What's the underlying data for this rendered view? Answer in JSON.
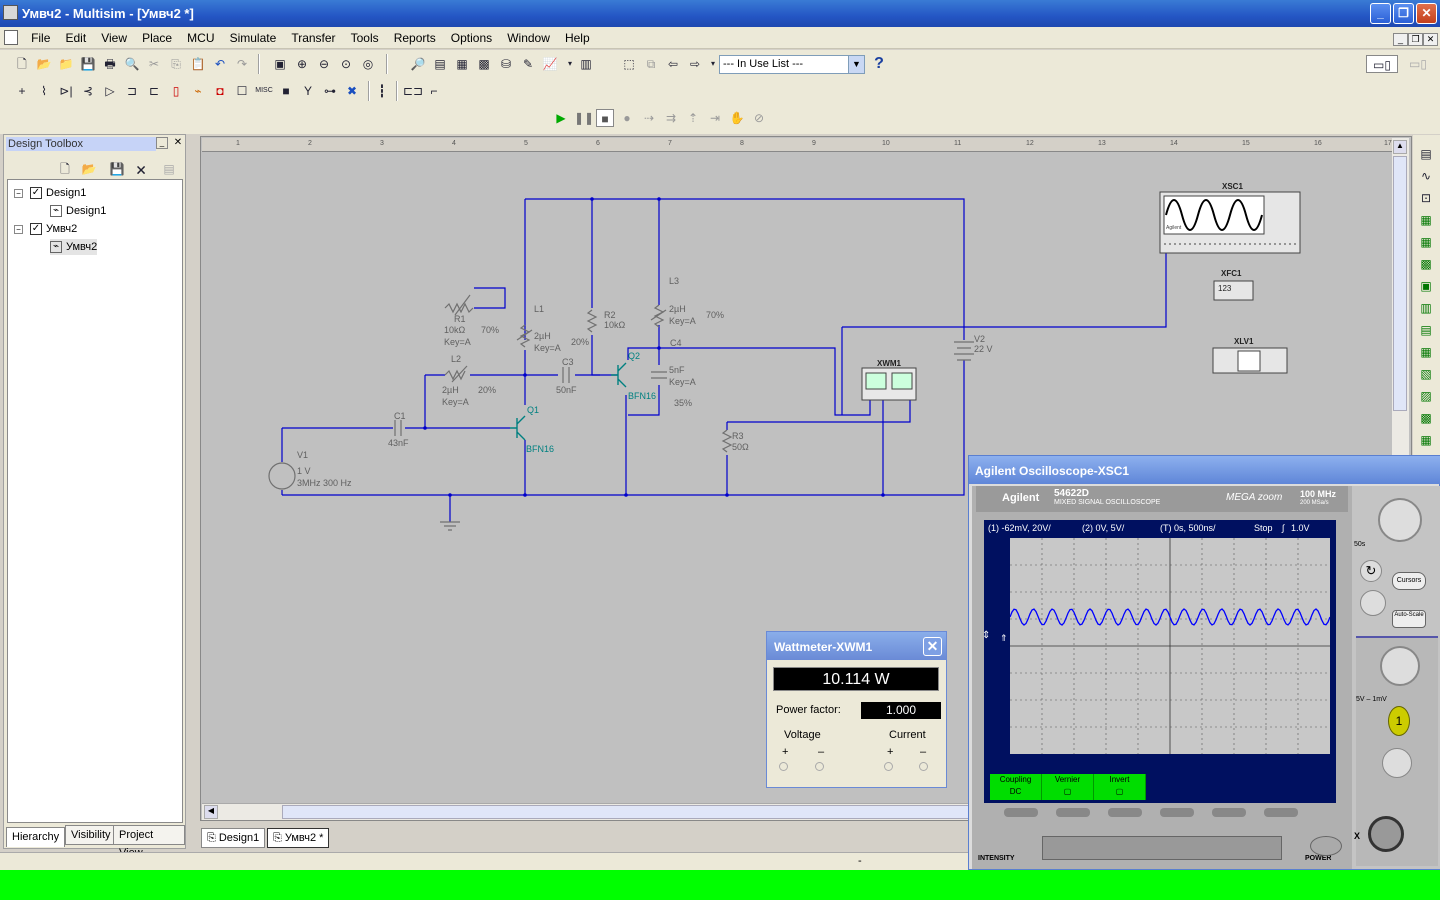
{
  "window": {
    "title": "Умвч2 - Multisim - [Умвч2 *]",
    "min_icon": "minimize-icon",
    "max_icon": "maximize-icon",
    "close_icon": "close-icon"
  },
  "menu": [
    "File",
    "Edit",
    "View",
    "Place",
    "MCU",
    "Simulate",
    "Transfer",
    "Tools",
    "Reports",
    "Options",
    "Window",
    "Help"
  ],
  "toolbar": {
    "in_use_list": "--- In Use List ---",
    "help_icon": "?"
  },
  "toolbox": {
    "title": "Design Toolbox",
    "tree": [
      {
        "label": "Design1",
        "level": 0
      },
      {
        "label": "Design1",
        "level": 1
      },
      {
        "label": "Умвч2",
        "level": 0
      },
      {
        "label": "Умвч2",
        "level": 1
      }
    ],
    "tabs": [
      "Hierarchy",
      "Visibility",
      "Project View"
    ]
  },
  "ruler": [
    "1",
    "2",
    "3",
    "4",
    "5",
    "6",
    "7",
    "8",
    "9",
    "10",
    "11",
    "12",
    "13",
    "14",
    "15",
    "16",
    "17"
  ],
  "schematic": {
    "r1": [
      "R1",
      "10kΩ",
      "Key=A",
      "70%"
    ],
    "l1": "L1",
    "l1_vals": [
      "2µH",
      "Key=A",
      "20%"
    ],
    "r2": [
      "R2",
      "10kΩ"
    ],
    "l3": "L3",
    "l3_vals": [
      "2µH",
      "Key=A",
      "70%"
    ],
    "c4": "C4",
    "c4_vals": [
      "5nF",
      "Key=A",
      "35%"
    ],
    "l2": "L2",
    "l2_vals": [
      "2µH",
      "Key=A",
      "20%"
    ],
    "c3": [
      "C3",
      "50nF"
    ],
    "q1": [
      "Q1",
      "BFN16"
    ],
    "q2": [
      "Q2",
      "BFN16"
    ],
    "c1": [
      "C1",
      "43nF"
    ],
    "v1": [
      "V1",
      "1 V",
      "3MHz 300 Hz"
    ],
    "r3": [
      "R3",
      "50Ω"
    ],
    "v2": [
      "V2",
      "22 V"
    ],
    "xwm1": "XWM1",
    "xsc1": "XSC1",
    "xfc1": "XFC1",
    "xfc1_val": "123",
    "xlv1": "XLV1",
    "xsc1_brand": "Agilent"
  },
  "doc_tabs": [
    "Design1",
    "Умвч2 *"
  ],
  "wattmeter": {
    "title": "Wattmeter-XWM1",
    "reading": "10.114 W",
    "pf_label": "Power factor:",
    "pf_value": "1.000",
    "voltage": "Voltage",
    "current": "Current",
    "plus": "+",
    "minus": "–"
  },
  "oscilloscope": {
    "title": "Agilent Oscilloscope-XSC1",
    "brand": "Agilent",
    "model": "54622D",
    "model_sub": "MIXED SIGNAL OSCILLOSCOPE",
    "megazoom": "MEGA zoom",
    "spec": "100 MHz",
    "spec_sub": "200 MSa/s",
    "ch1": "(1) -62mV, 20V/",
    "ch2": "(2) 0V, 5V/",
    "timebase": "(T) 0s, 500ns/",
    "run_state": "Stop",
    "trigger": "1.0V",
    "softkeys": [
      {
        "top": "Coupling",
        "bottom": "DC"
      },
      {
        "top": "Vernier",
        "bottom": ""
      },
      {
        "top": "Invert",
        "bottom": ""
      }
    ],
    "side_labels": [
      "50s",
      "Cursors",
      "Auto-Scale",
      "5V – 1mV",
      "1",
      "X",
      "INTENSITY",
      "POWER"
    ]
  },
  "colors": {
    "wire": "#0000cc",
    "component": "#707070",
    "transistor": "#008080",
    "trace": "#0000ff",
    "green_bar": "#00ff00"
  }
}
